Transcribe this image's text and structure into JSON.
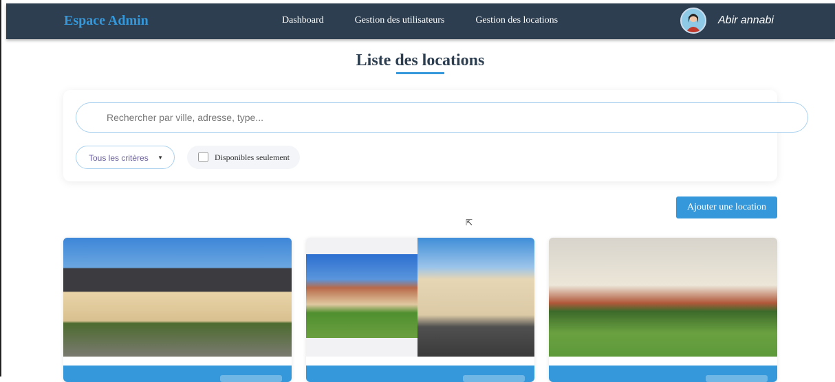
{
  "navbar": {
    "brand": "Espace Admin",
    "links": [
      "Dashboard",
      "Gestion des utilisateurs",
      "Gestion des locations"
    ],
    "user_name": "Abir annabi"
  },
  "page": {
    "title": "Liste des locations"
  },
  "filters": {
    "search_placeholder": "Rechercher par ville, adresse, type...",
    "criteria_select": "Tous les critères",
    "available_only_label": "Disponibles seulement",
    "available_only_checked": false
  },
  "actions": {
    "add_label": "Ajouter une location"
  },
  "colors": {
    "nav": "#2c3e50",
    "accent": "#3498db"
  }
}
